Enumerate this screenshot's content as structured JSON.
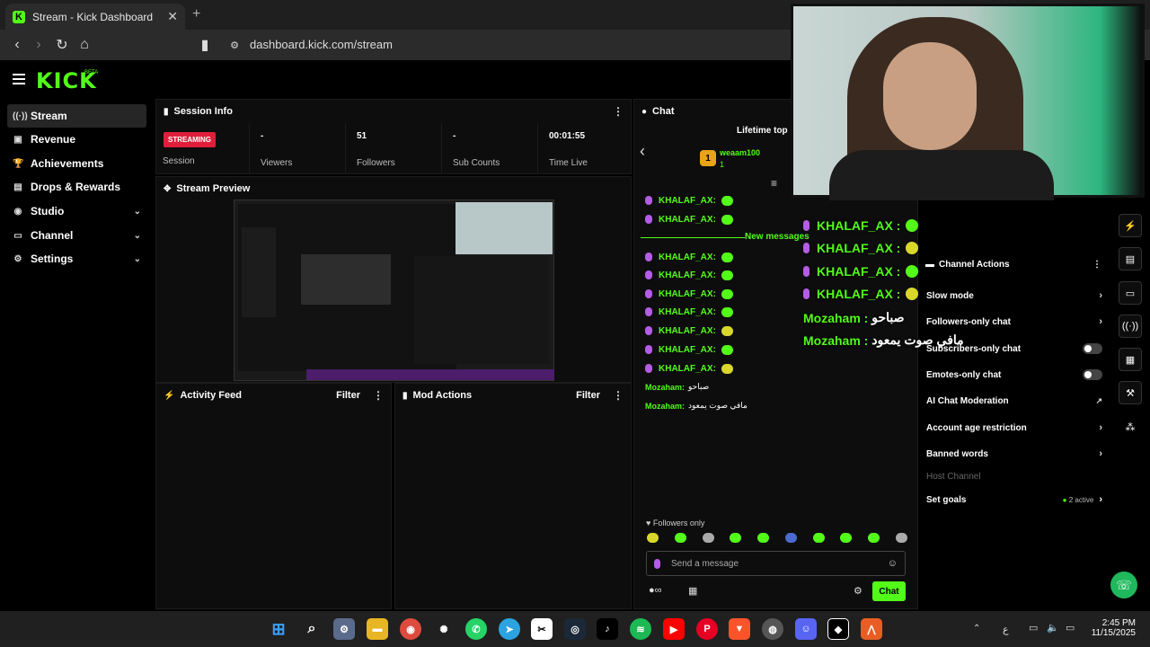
{
  "browser": {
    "tab_title": "Stream - Kick Dashboard",
    "url": "dashboard.kick.com/stream"
  },
  "header": {
    "logo": "KICK",
    "beta": "BETA"
  },
  "sidebar": {
    "items": [
      {
        "label": "Stream",
        "icon": "broadcast-icon"
      },
      {
        "label": "Revenue",
        "icon": "revenue-icon"
      },
      {
        "label": "Achievements",
        "icon": "trophy-icon"
      },
      {
        "label": "Drops & Rewards",
        "icon": "gift-icon"
      },
      {
        "label": "Studio",
        "icon": "studio-icon"
      },
      {
        "label": "Channel",
        "icon": "channel-icon"
      },
      {
        "label": "Settings",
        "icon": "gear-icon"
      }
    ]
  },
  "session": {
    "title": "Session Info",
    "status": "STREAMING",
    "session_label": "Session",
    "viewers_value": "-",
    "viewers_label": "Viewers",
    "followers_value": "51",
    "followers_label": "Followers",
    "subs_value": "-",
    "subs_label": "Sub Counts",
    "time_value": "00:01:55",
    "time_label": "Time Live"
  },
  "preview": {
    "title": "Stream Preview"
  },
  "activity": {
    "title": "Activity Feed",
    "filter": "Filter"
  },
  "mod": {
    "title": "Mod Actions",
    "filter": "Filter"
  },
  "chat": {
    "title": "Chat",
    "lifetime": "Lifetime top",
    "top_user": "weaam100",
    "top_rank": "1",
    "new_messages": "New messages",
    "separator": ":",
    "messages": [
      {
        "user": "KHALAF_AX"
      },
      {
        "user": "KHALAF_AX"
      },
      {
        "user": "KHALAF_AX"
      },
      {
        "user": "KHALAF_AX"
      },
      {
        "user": "KHALAF_AX"
      },
      {
        "user": "KHALAF_AX"
      },
      {
        "user": "KHALAF_AX"
      },
      {
        "user": "KHALAF_AX"
      },
      {
        "user": "KHALAF_AX"
      }
    ],
    "moz_messages": [
      {
        "user": "Mozaham:",
        "text": "صباحو"
      },
      {
        "user": "Mozaham:",
        "text": "مافي صوت يمعود"
      }
    ],
    "followers_only": "Followers only",
    "placeholder": "Send a message",
    "send_label": "Chat"
  },
  "overlay": {
    "messages": [
      {
        "user": "KHALAF_AX :"
      },
      {
        "user": "KHALAF_AX :"
      },
      {
        "user": "KHALAF_AX :"
      },
      {
        "user": "KHALAF_AX :"
      }
    ],
    "moz": [
      {
        "user": "Mozaham :",
        "text": "صباحو"
      },
      {
        "user": "Mozaham :",
        "text": "مافي صوت يمعود"
      }
    ]
  },
  "channel_actions": {
    "title": "Channel Actions",
    "slow_mode": "Slow mode",
    "followers_only": "Followers-only chat",
    "subscribers_only": "Subscribers-only chat",
    "emotes_only": "Emotes-only chat",
    "ai_moderation": "AI Chat Moderation",
    "account_age": "Account age restriction",
    "banned_words": "Banned words",
    "host_channel": "Host Channel",
    "set_goals": "Set goals",
    "goals_active": "2 active"
  },
  "taskbar": {
    "lang": "ع",
    "time": "2:45 PM",
    "date": "11/15/2025"
  },
  "colors": {
    "accent": "#53fc18",
    "live": "#e01e3b",
    "bg": "#000000"
  }
}
